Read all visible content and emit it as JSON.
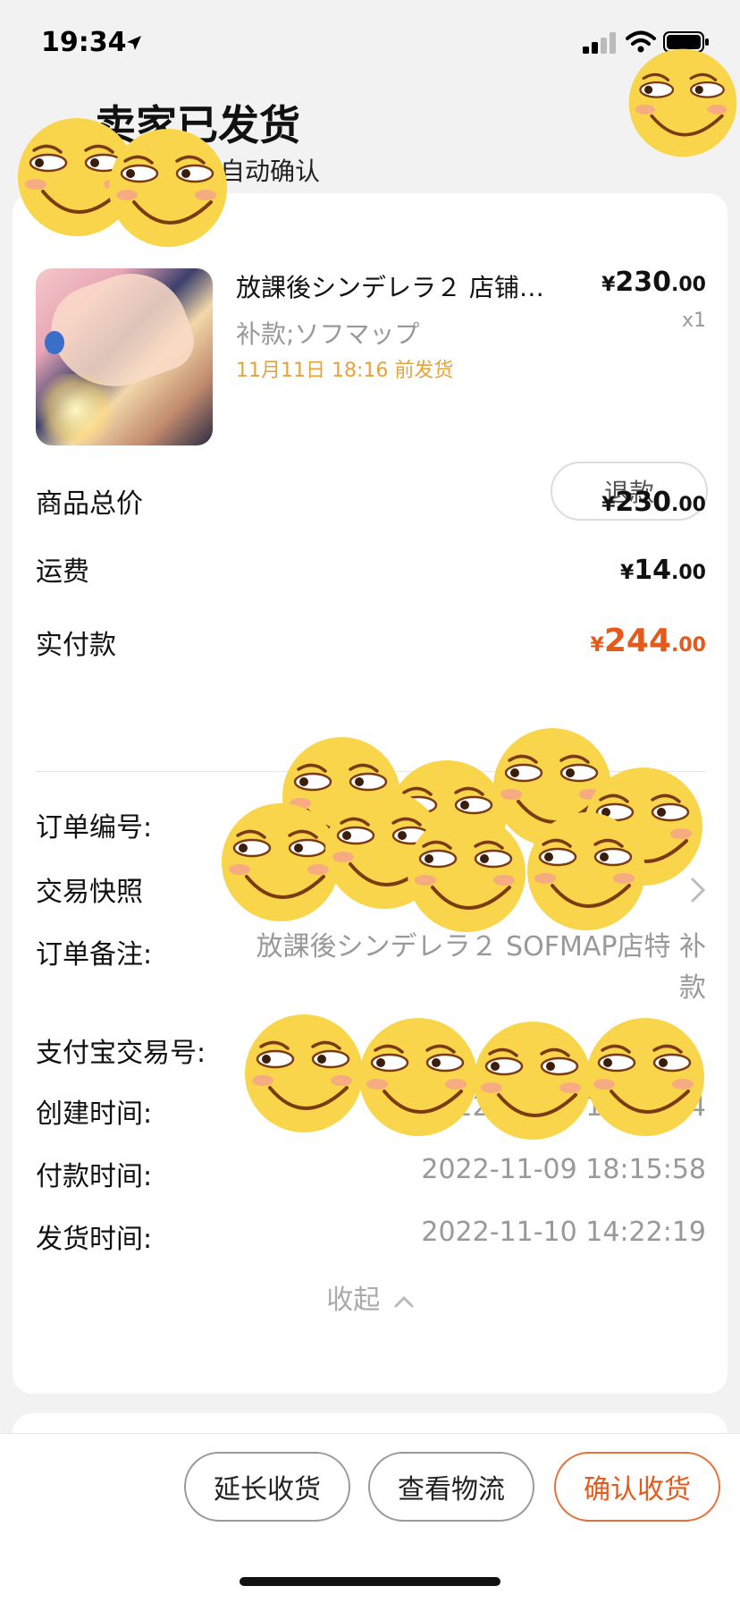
{
  "status_bar": {
    "time": "19:34",
    "icons": [
      "location-arrow-icon",
      "signal-icon",
      "wifi-icon",
      "battery-icon"
    ]
  },
  "header": {
    "title": "卖家已发货",
    "subtitle": "寸自动确认"
  },
  "product": {
    "title": "放課後シンデレラ２ 店铺…",
    "sku": "补款;ソフマップ",
    "ship_by": "11月11日 18:16 前发货",
    "price": {
      "yen": "¥",
      "int": "230",
      "dec": ".00"
    },
    "quantity": "x1",
    "refund_label": "退款"
  },
  "summary": {
    "goods_total_label": "商品总价",
    "goods_total": {
      "yen": "¥",
      "int": "230",
      "dec": ".00"
    },
    "shipping_label": "运费",
    "shipping": {
      "yen": "¥",
      "int": "14",
      "dec": ".00"
    },
    "paid_label": "实付款",
    "paid": {
      "yen": "¥",
      "int": "244",
      "dec": ".00"
    }
  },
  "order_info": {
    "order_no_label": "订单编号:",
    "snapshot_label": "交易快照",
    "remark_label": "订单备注:",
    "remark_value": "放課後シンデレラ２ SOFMAP店特 补款",
    "alipay_label": "支付宝交易号:",
    "created_label": "创建时间:",
    "created_value": "2022-11-09 18:15:54",
    "paid_time_label": "付款时间:",
    "paid_time_value": "2022-11-09 18:15:58",
    "shipped_label": "发货时间:",
    "shipped_value": "2022-11-10 14:22:19",
    "collapse_label": "收起"
  },
  "actions": {
    "extend_label": "延长收货",
    "logistics_label": "查看物流",
    "confirm_label": "确认收货"
  },
  "colors": {
    "accent_orange": "#e5591a",
    "ship_yellow": "#e5a33a",
    "muted_text": "#999999",
    "background": "#f2f2f2"
  }
}
